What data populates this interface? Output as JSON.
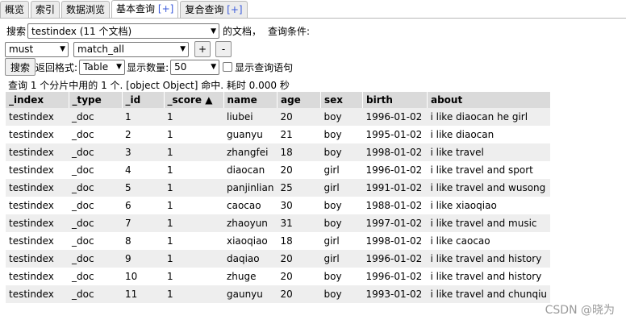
{
  "tabs": [
    {
      "label": "概览",
      "active": false
    },
    {
      "label": "索引",
      "active": false
    },
    {
      "label": "数据浏览",
      "active": false
    },
    {
      "label": "基本查询",
      "plus": "[+]",
      "active": true
    },
    {
      "label": "复合查询",
      "plus": "[+]",
      "active": false
    }
  ],
  "query": {
    "search_label": "搜索",
    "index_select": "testindex (11 个文档)",
    "docs_suffix": "的文档，",
    "condition_label": "查询条件:",
    "bool_select": "must",
    "type_select": "match_all",
    "add_btn": "+",
    "remove_btn": "-",
    "search_btn": "搜索",
    "return_label": "返回格式:",
    "format_select": "Table",
    "count_label": "显示数量:",
    "count_select": "50",
    "show_query_label": "显示查询语句"
  },
  "summary": "查询 1 个分片中用的 1 个. [object Object] 命中. 耗时 0.000 秒",
  "table": {
    "headers": [
      "_index",
      "_type",
      "_id",
      "_score ▲",
      "name",
      "age",
      "sex",
      "birth",
      "about"
    ],
    "rows": [
      [
        "testindex",
        "_doc",
        "1",
        "1",
        "liubei",
        "20",
        "boy",
        "1996-01-02",
        "i like diaocan he girl"
      ],
      [
        "testindex",
        "_doc",
        "2",
        "1",
        "guanyu",
        "21",
        "boy",
        "1995-01-02",
        "i like diaocan"
      ],
      [
        "testindex",
        "_doc",
        "3",
        "1",
        "zhangfei",
        "18",
        "boy",
        "1998-01-02",
        "i like travel"
      ],
      [
        "testindex",
        "_doc",
        "4",
        "1",
        "diaocan",
        "20",
        "girl",
        "1996-01-02",
        "i like travel and sport"
      ],
      [
        "testindex",
        "_doc",
        "5",
        "1",
        "panjinlian",
        "25",
        "girl",
        "1991-01-02",
        "i like travel and wusong"
      ],
      [
        "testindex",
        "_doc",
        "6",
        "1",
        "caocao",
        "30",
        "boy",
        "1988-01-02",
        "i like xiaoqiao"
      ],
      [
        "testindex",
        "_doc",
        "7",
        "1",
        "zhaoyun",
        "31",
        "boy",
        "1997-01-02",
        "i like travel and music"
      ],
      [
        "testindex",
        "_doc",
        "8",
        "1",
        "xiaoqiao",
        "18",
        "girl",
        "1998-01-02",
        "i like caocao"
      ],
      [
        "testindex",
        "_doc",
        "9",
        "1",
        "daqiao",
        "20",
        "girl",
        "1996-01-02",
        "i like travel and history"
      ],
      [
        "testindex",
        "_doc",
        "10",
        "1",
        "zhuge",
        "20",
        "boy",
        "1996-01-02",
        "i like travel and history"
      ],
      [
        "testindex",
        "_doc",
        "11",
        "1",
        "gaunyu",
        "20",
        "boy",
        "1993-01-02",
        "i like travel and chunqiu"
      ]
    ]
  },
  "watermark": "CSDN @晓为"
}
